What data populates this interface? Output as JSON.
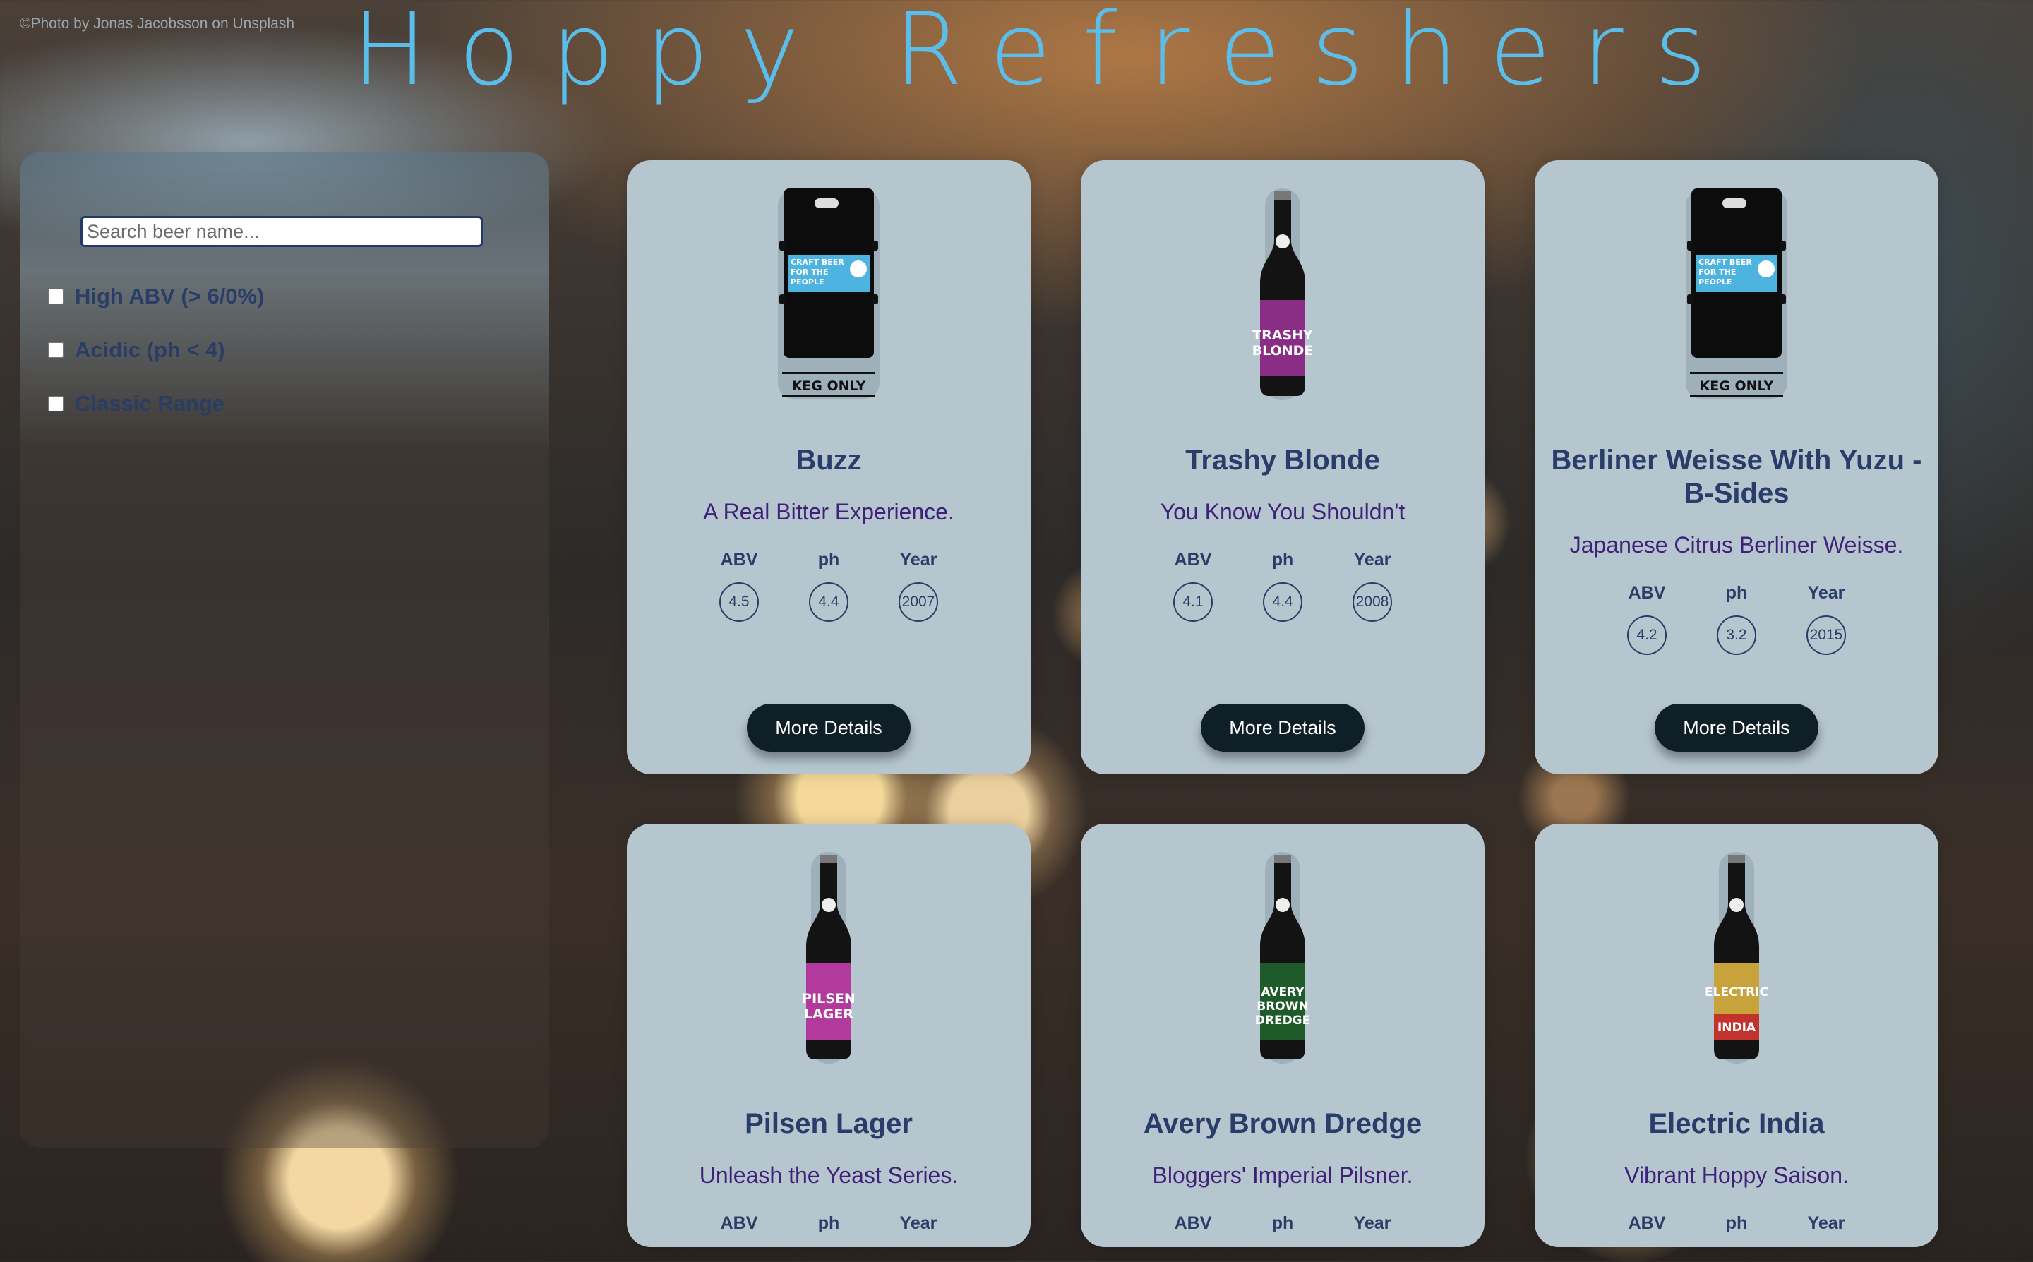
{
  "photo_credit": "©Photo by Jonas Jacobsson on Unsplash",
  "app_title": "Hoppy Refreshers",
  "search": {
    "placeholder": "Search beer name..."
  },
  "filters": [
    {
      "label": "High ABV (> 6/0%)",
      "checked": false
    },
    {
      "label": "Acidic (ph < 4)",
      "checked": false
    },
    {
      "label": "Classic Range",
      "checked": false
    }
  ],
  "stat_labels": {
    "abv": "ABV",
    "ph": "ph",
    "year": "Year"
  },
  "more_details_label": "More Details",
  "beers": [
    {
      "name": "Buzz",
      "tagline": "A Real Bitter Experience.",
      "abv": "4.5",
      "ph": "4.4",
      "year": "2007",
      "image": "keg-icon"
    },
    {
      "name": "Trashy Blonde",
      "tagline": "You Know You Shouldn't",
      "abv": "4.1",
      "ph": "4.4",
      "year": "2008",
      "image": "bottle-icon",
      "label_color": "#8a2e85",
      "label_text": "TRASHY BLONDE"
    },
    {
      "name": "Berliner Weisse With Yuzu - B-Sides",
      "tagline": "Japanese Citrus Berliner Weisse.",
      "abv": "4.2",
      "ph": "3.2",
      "year": "2015",
      "image": "keg-icon"
    },
    {
      "name": "Pilsen Lager",
      "tagline": "Unleash the Yeast Series.",
      "image": "bottle-icon",
      "label_color": "#b13a9c",
      "label_text": "PILSEN LAGER"
    },
    {
      "name": "Avery Brown Dredge",
      "tagline": "Bloggers' Imperial Pilsner.",
      "image": "bottle-icon",
      "label_color": "#1f5a2a",
      "label_text": "AVERY BROWN DREDGE"
    },
    {
      "name": "Electric India",
      "tagline": "Vibrant Hoppy Saison.",
      "image": "bottle-icon",
      "label_color": "#c8a23a",
      "label_text": "ELECTRIC INDIA"
    }
  ],
  "keg_label": {
    "banner": "CRAFT BEER FOR THE PEOPLE",
    "footer": "KEG ONLY",
    "color": "#4db3e0"
  }
}
